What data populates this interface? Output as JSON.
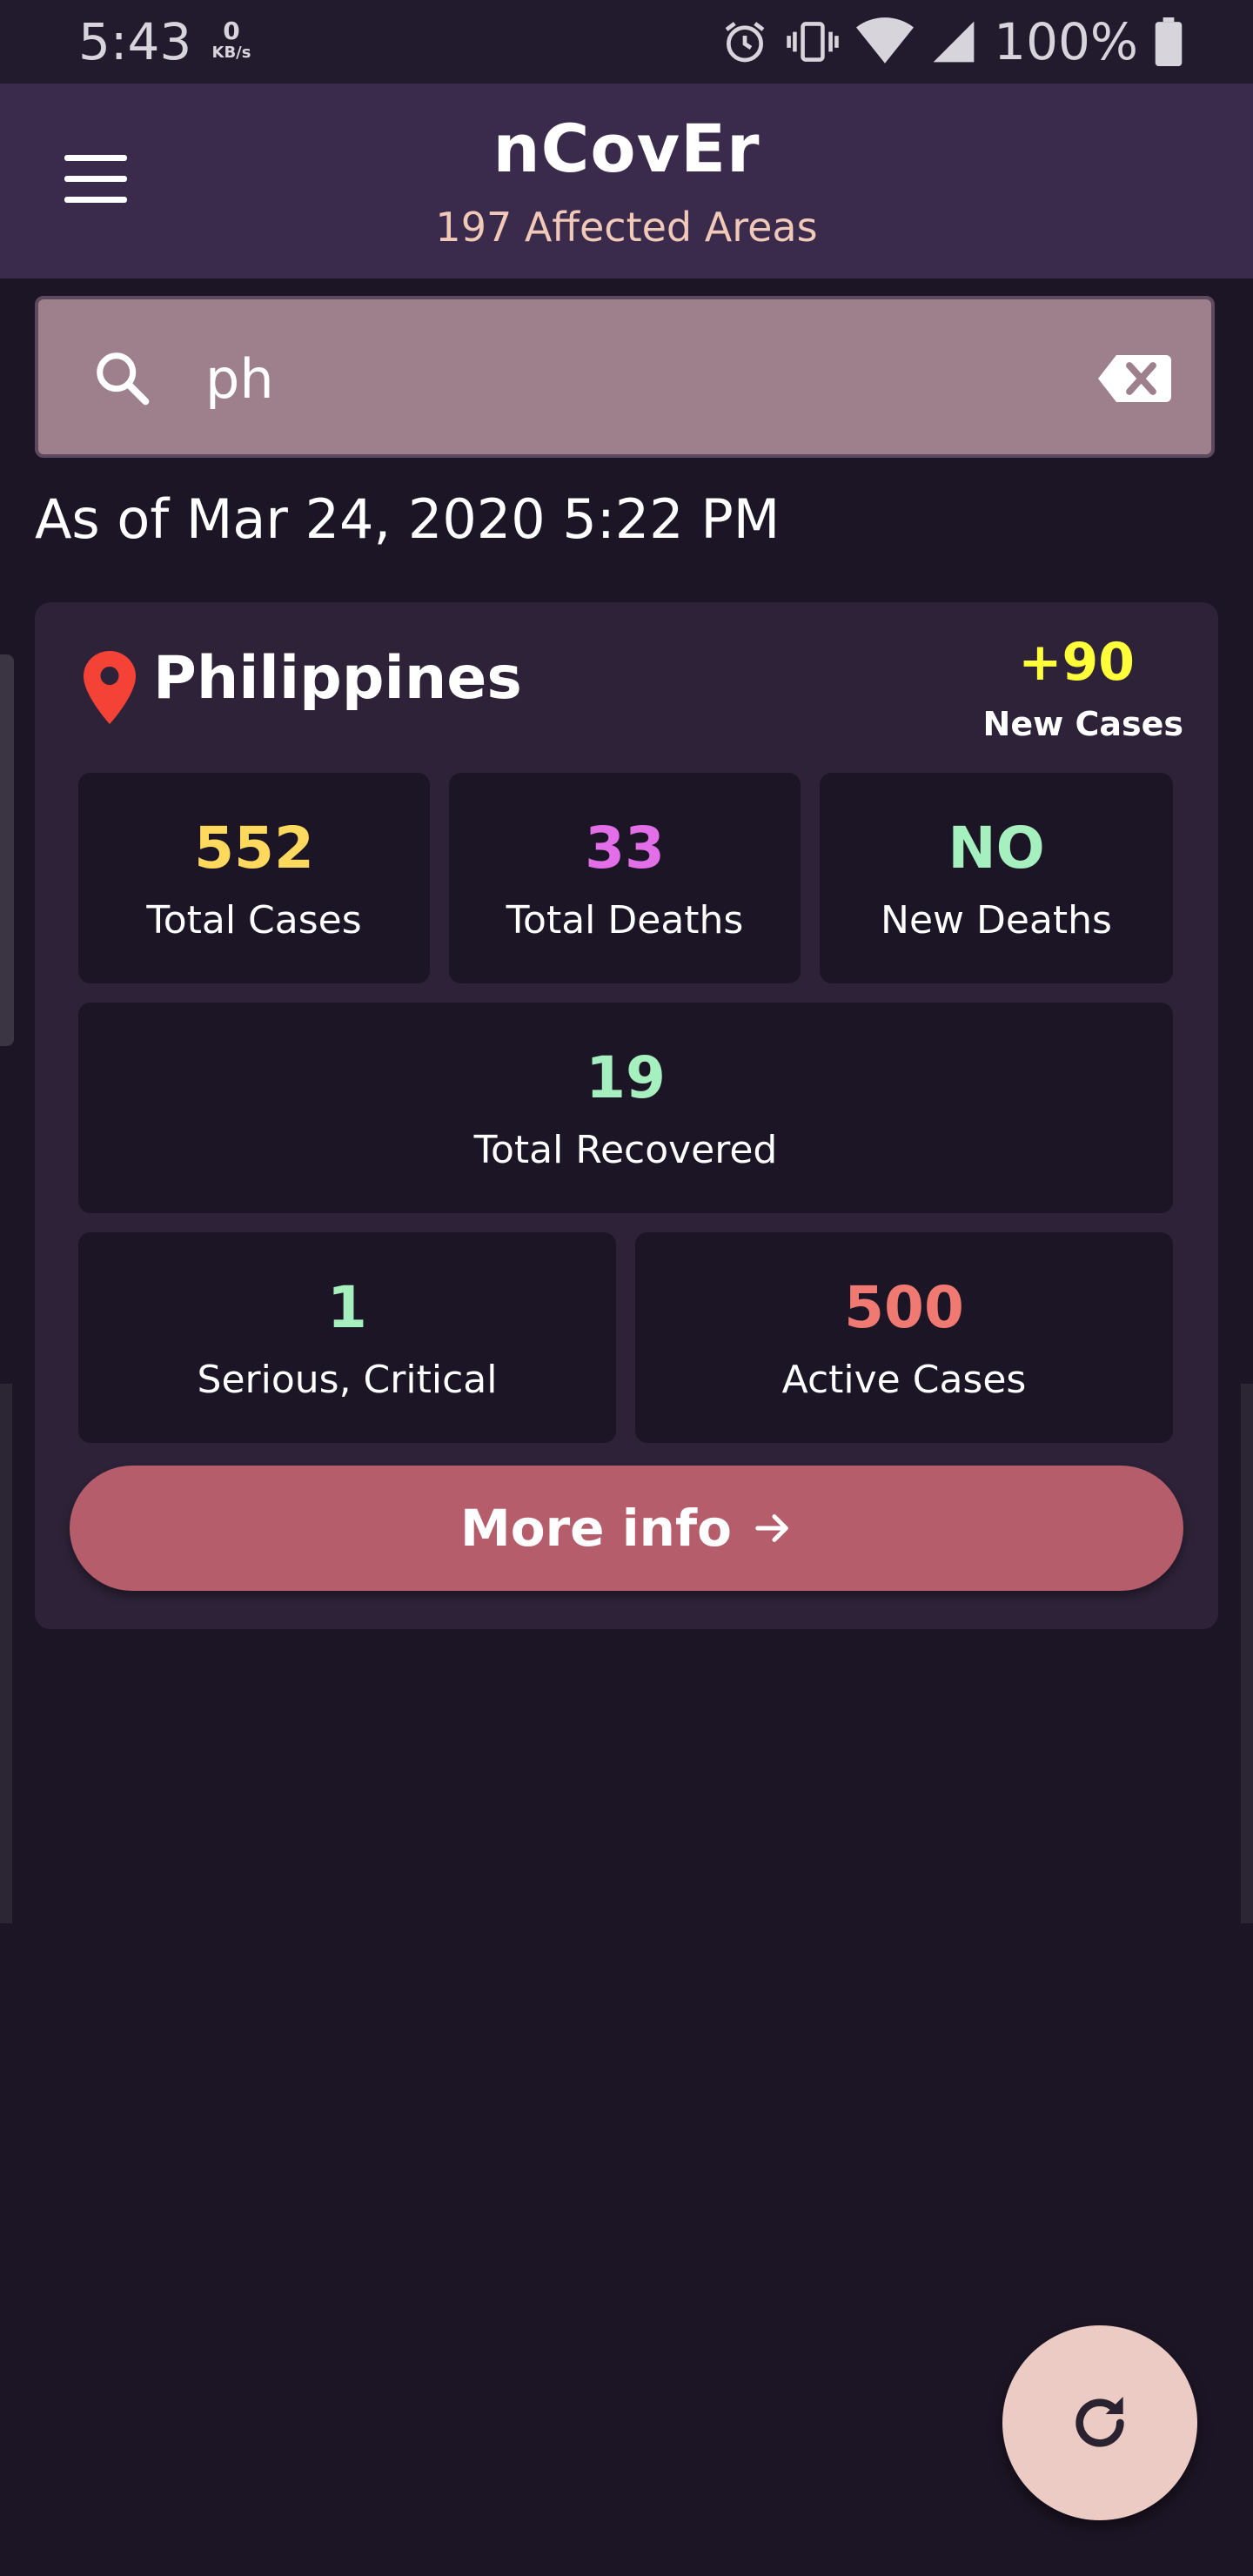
{
  "status_bar": {
    "time": "5:43",
    "net_speed_value": "0",
    "net_speed_unit": "KB/s",
    "battery_percent": "100%",
    "icons": [
      "alarm-icon",
      "vibrate-icon",
      "wifi-icon",
      "signal-icon",
      "battery-icon"
    ]
  },
  "app_bar": {
    "title": "nCovEr",
    "subtitle": "197 Affected Areas",
    "menu_icon": "hamburger-menu-icon"
  },
  "search": {
    "value": "ph",
    "icon": "search-icon",
    "clear_icon": "backspace-clear-icon"
  },
  "as_of": "As of Mar 24, 2020 5:22 PM",
  "country_card": {
    "country": "Philippines",
    "location_icon": "location-pin-icon",
    "new_cases_value": "+90",
    "new_cases_label": "New Cases",
    "stats": {
      "total_cases": {
        "value": "552",
        "label": "Total Cases",
        "color": "#ffd95e"
      },
      "total_deaths": {
        "value": "33",
        "label": "Total Deaths",
        "color": "#e36fe8"
      },
      "new_deaths": {
        "value": "NO",
        "label": "New Deaths",
        "color": "#a6f0c0"
      },
      "total_recovered": {
        "value": "19",
        "label": "Total Recovered",
        "color": "#a6f0c0"
      },
      "serious_critical": {
        "value": "1",
        "label": "Serious, Critical",
        "color": "#a6f0c0"
      },
      "active_cases": {
        "value": "500",
        "label": "Active Cases",
        "color": "#f07a72"
      }
    },
    "more_info_label": "More info",
    "more_info_icon": "arrow-right-icon"
  },
  "fab": {
    "icon": "refresh-icon"
  },
  "colors": {
    "background": "#1c1525",
    "app_bar": "#3a2a4b",
    "card": "#2d2238",
    "button": "#b65d6b",
    "fab": "#ebcbc3",
    "subtitle": "#f1c9b8",
    "new_cases": "#ffff3a"
  }
}
